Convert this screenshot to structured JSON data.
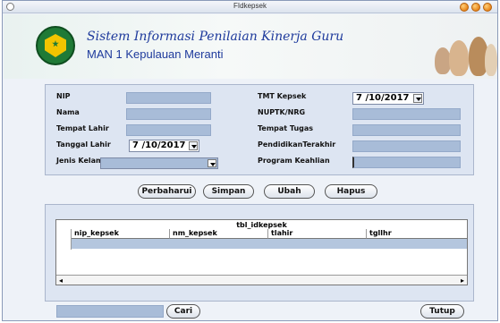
{
  "window": {
    "title": "FIdkepsek"
  },
  "header": {
    "app_title": "Sistem Informasi Penilaian Kinerja Guru",
    "school": "MAN 1 Kepulauan Meranti"
  },
  "form": {
    "nip_label": "NIP",
    "nama_label": "Nama",
    "tempat_lahir_label": "Tempat Lahir",
    "tanggal_lahir_label": "Tanggal Lahir",
    "tanggal_lahir_value": "7 /10/2017",
    "jenis_kelamin_label": "Jenis Kelamin",
    "tmt_kepsek_label": "TMT Kepsek",
    "tmt_kepsek_value": "7 /10/2017",
    "nuptk_label": "NUPTK/NRG",
    "tempat_tugas_label": "Tempat Tugas",
    "pendidikan_label": "PendidikanTerakhir",
    "program_label": "Program Keahlian"
  },
  "buttons": {
    "perbaharui": "Perbaharui",
    "simpan": "Simpan",
    "ubah": "Ubah",
    "hapus": "Hapus",
    "cari": "Cari",
    "tutup": "Tutup"
  },
  "table": {
    "title": "tbl_idkepsek",
    "columns": [
      "nip_kepsek",
      "nm_kepsek",
      "tlahir",
      "tgllhr"
    ]
  },
  "colors": {
    "field": "#a8bcd8",
    "panel": "#dde5f2",
    "title_text": "#1e3a9c"
  }
}
